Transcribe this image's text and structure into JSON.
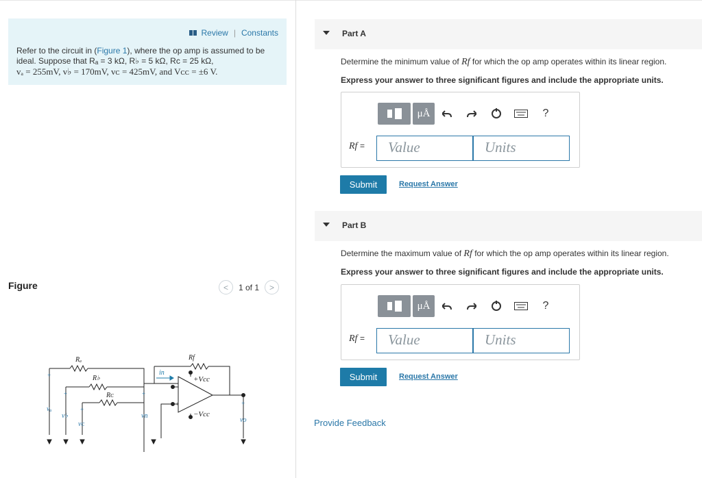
{
  "intro": {
    "review_label": "Review",
    "separator": "|",
    "constants_label": "Constants",
    "line1_pre": "Refer to the circuit in (",
    "figure_link": "Figure 1",
    "line1_post": "), where the op amp is assumed to be",
    "line2": "ideal. Suppose that Rₐ = 3 kΩ, R♭ = 5 kΩ, Rᴄ = 25 kΩ,",
    "line3": "vₐ = 255mV, v♭ = 170mV, vᴄ = 425mV, and Vᴄᴄ = ±6 V."
  },
  "figure": {
    "title": "Figure",
    "pager": "1 of 1",
    "prev_glyph": "<",
    "next_glyph": ">",
    "labels": {
      "ra": "Rₐ",
      "rb": "R♭",
      "rc": "Rᴄ",
      "rf": "Rf",
      "vcc_pos": "+Vcc",
      "vcc_neg": "−Vcc",
      "va": "vₐ",
      "vb": "v♭",
      "vc": "vᴄ",
      "vn": "vn",
      "vo": "vo",
      "in": "in"
    }
  },
  "parts": [
    {
      "title": "Part A",
      "question_pre": "Determine the minimum value of ",
      "question_var": "Rf",
      "question_post": " for which the op amp operates within its linear region.",
      "instruction": "Express your answer to three significant figures and include the appropriate units.",
      "label": "Rf",
      "label_eq": "=",
      "value_placeholder": "Value",
      "units_placeholder": "Units",
      "submit_label": "Submit",
      "request_label": "Request Answer"
    },
    {
      "title": "Part B",
      "question_pre": "Determine the maximum value of ",
      "question_var": "Rf",
      "question_post": " for which the op amp operates within its linear region.",
      "instruction": "Express your answer to three significant figures and include the appropriate units.",
      "label": "Rf",
      "label_eq": "=",
      "value_placeholder": "Value",
      "units_placeholder": "Units",
      "submit_label": "Submit",
      "request_label": "Request Answer"
    }
  ],
  "toolbar": {
    "mu_label": "μÅ",
    "help_label": "?"
  },
  "feedback_label": "Provide Feedback",
  "colors": {
    "accent": "#2a77a8",
    "submit": "#1e7ba8",
    "intro_bg": "#e5f4f8"
  }
}
